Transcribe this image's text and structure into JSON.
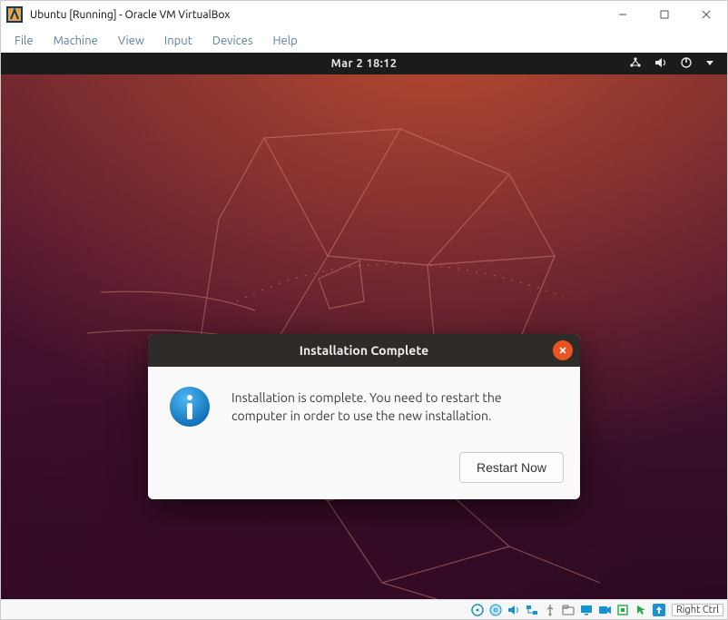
{
  "vbox": {
    "title": "Ubuntu [Running] - Oracle VM VirtualBox",
    "menus": {
      "file": "File",
      "machine": "Machine",
      "view": "View",
      "input": "Input",
      "devices": "Devices",
      "help": "Help"
    },
    "hostkey_label": "Right Ctrl"
  },
  "ubuntu_topbar": {
    "datetime": "Mar 2  18:12"
  },
  "dialog": {
    "title": "Installation Complete",
    "message": "Installation is complete. You need to restart the computer in order to use the new installation.",
    "restart_label": "Restart Now"
  },
  "colors": {
    "ubuntu_orange": "#e95420",
    "info_blue": "#1e8fe1"
  }
}
